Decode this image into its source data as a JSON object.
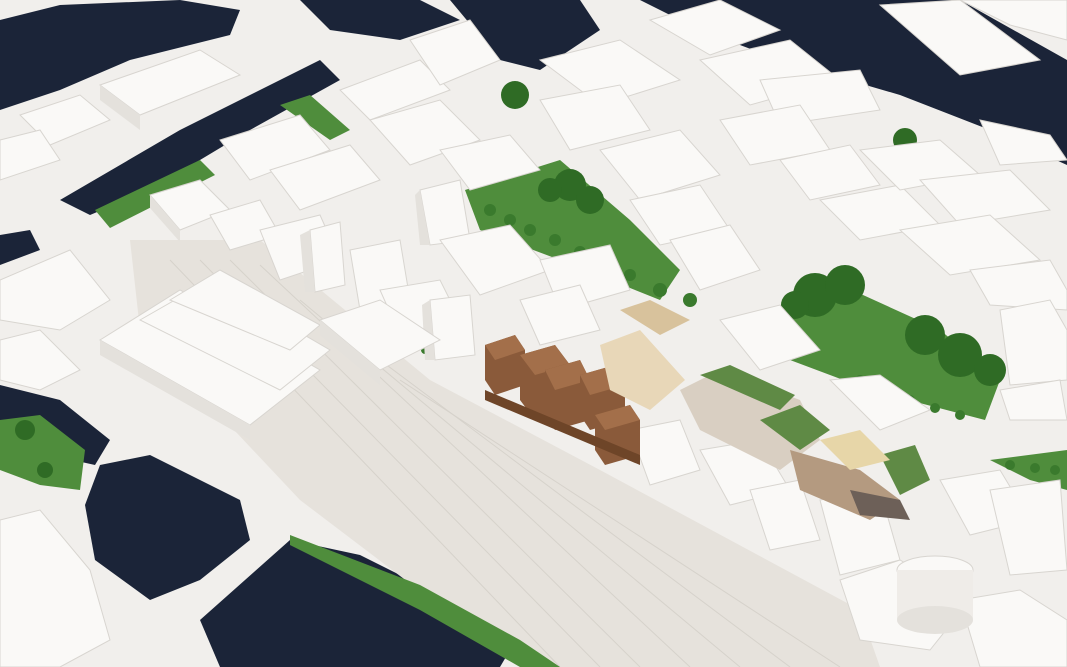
{
  "scene": {
    "kind": "aerial-city-rendering",
    "colors": {
      "ground": "#f1efec",
      "water": "#1b2438",
      "park": "#4f8d3c",
      "trees": "#2f6b25",
      "buildings": "#faf9f7",
      "building_shadow": "#e4e1dc",
      "proposal_brown": "#8a5a3a",
      "proposal_green_roof": "#5f8a45",
      "rail": "#e6e2dc"
    }
  }
}
